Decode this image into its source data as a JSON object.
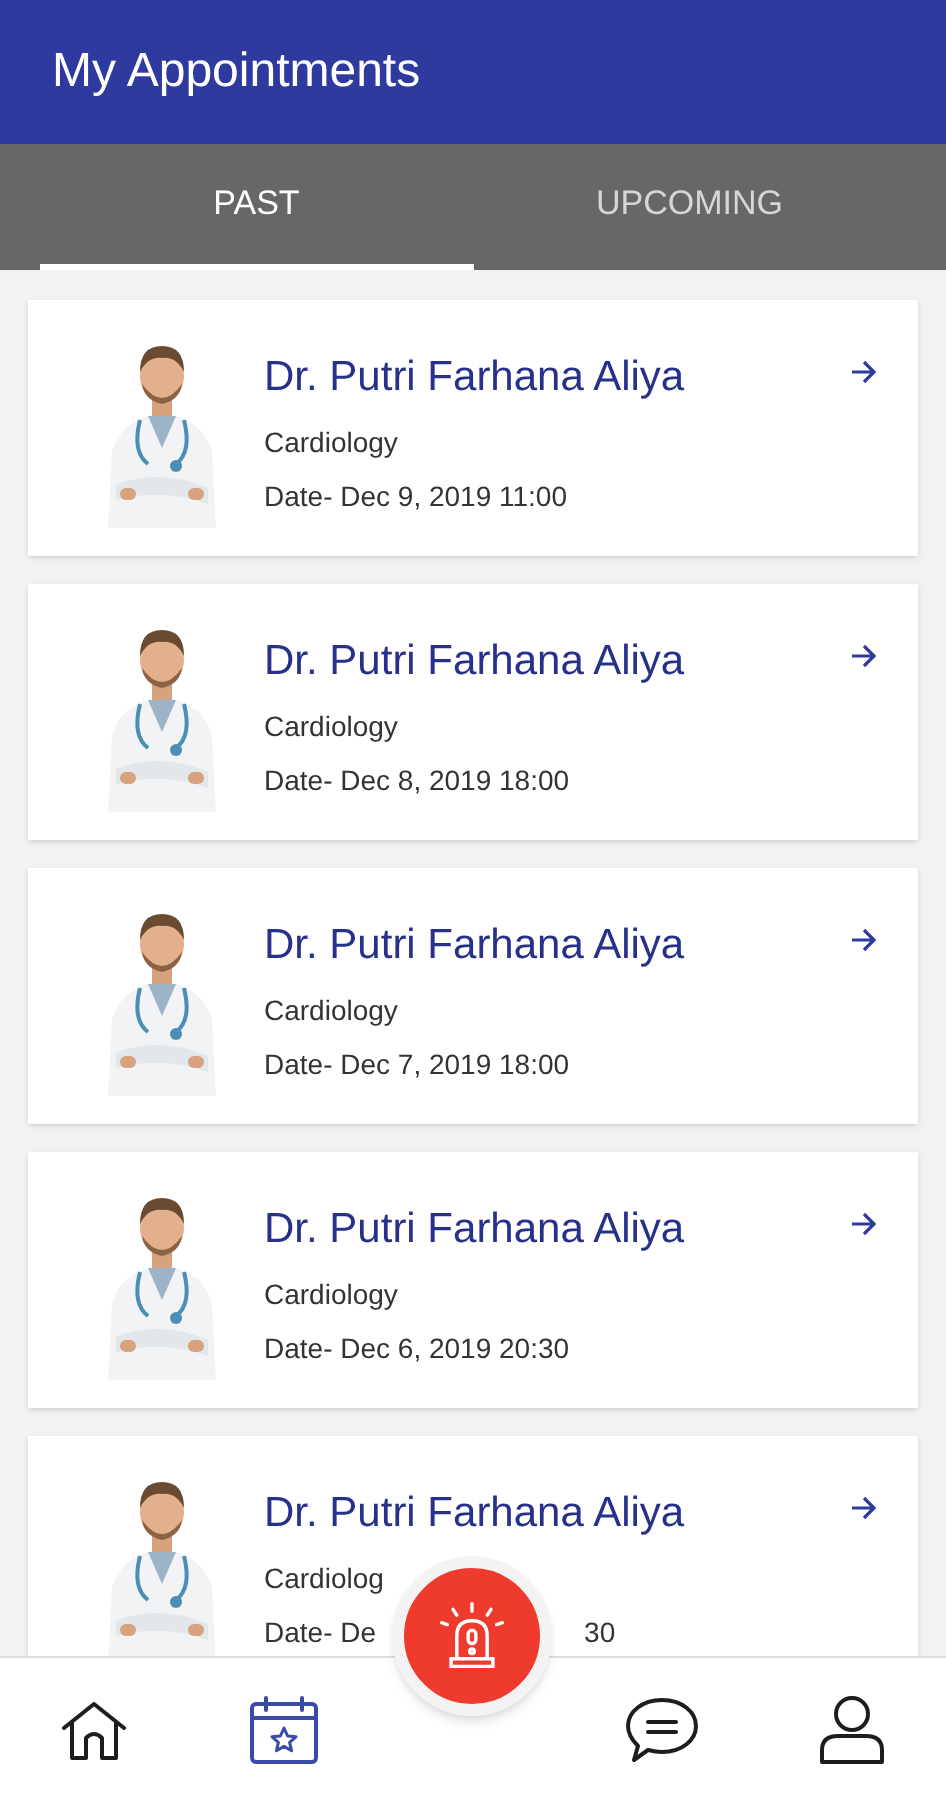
{
  "header": {
    "title": "My Appointments"
  },
  "tabs": [
    {
      "label": "PAST",
      "selected": true
    },
    {
      "label": "UPCOMING",
      "selected": false
    }
  ],
  "appointments": [
    {
      "doctor": "Dr. Putri Farhana Aliya",
      "specialty": "Cardiology",
      "date": "Date- Dec 9, 2019 11:00"
    },
    {
      "doctor": "Dr. Putri Farhana Aliya",
      "specialty": "Cardiology",
      "date": "Date- Dec 8, 2019 18:00"
    },
    {
      "doctor": "Dr. Putri Farhana Aliya",
      "specialty": "Cardiology",
      "date": "Date- Dec 7, 2019 18:00"
    },
    {
      "doctor": "Dr. Putri Farhana Aliya",
      "specialty": "Cardiology",
      "date": "Date- Dec 6, 2019 20:30"
    },
    {
      "doctor": "Dr. Putri Farhana Aliya",
      "specialty": "Cardiolog",
      "date": "Date- De",
      "date_tail": "30"
    }
  ],
  "bottom_nav": [
    {
      "kind": "home",
      "selected": false
    },
    {
      "kind": "appointments",
      "selected": true
    },
    {
      "kind": "emergency",
      "selected": false
    },
    {
      "kind": "chat",
      "selected": false
    },
    {
      "kind": "profile",
      "selected": false
    }
  ]
}
